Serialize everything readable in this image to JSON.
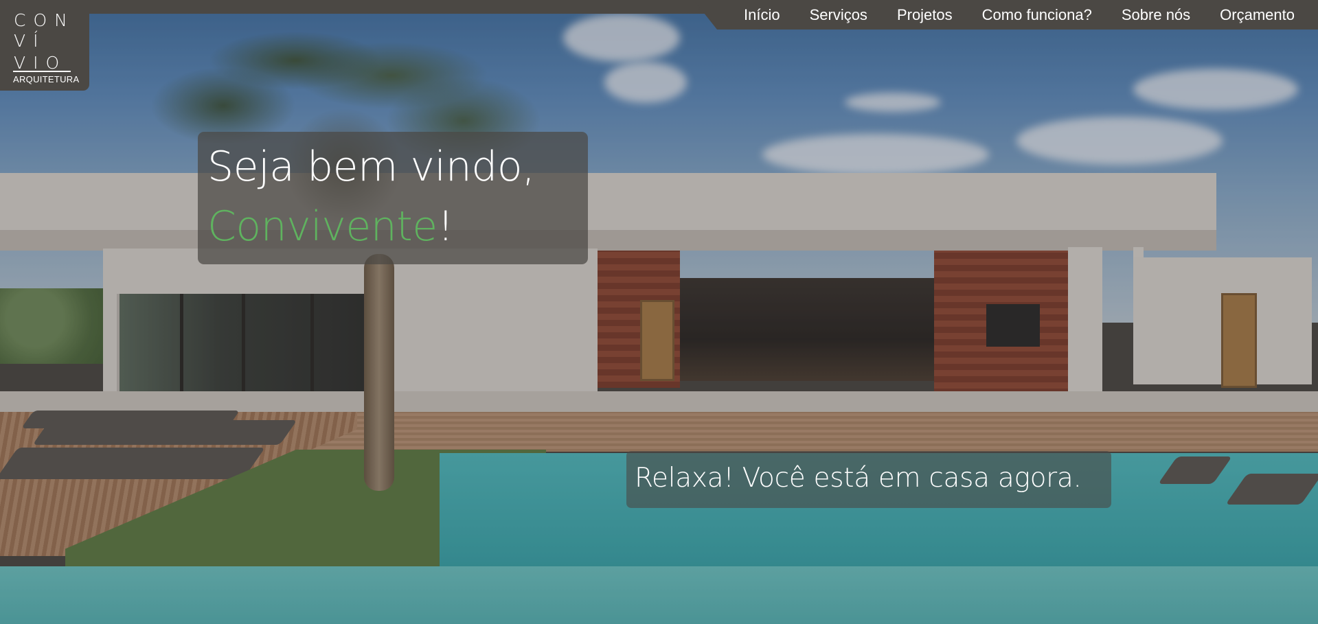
{
  "logo": {
    "line1": "CON",
    "line2": "VÍ",
    "line3": "VIO",
    "subtitle": "ARQUITETURA",
    "icon": "convivio-logo-icon"
  },
  "nav": {
    "items": [
      {
        "label": "Início"
      },
      {
        "label": "Serviços"
      },
      {
        "label": "Projetos"
      },
      {
        "label": "Como funciona?"
      },
      {
        "label": "Sobre nós"
      },
      {
        "label": "Orçamento"
      }
    ]
  },
  "hero": {
    "greeting": "Seja bem vindo,",
    "name": "Convivente",
    "punctuation": "!",
    "tagline": "Relaxa! Você está em casa agora."
  },
  "colors": {
    "nav_background": "#4b4844",
    "accent_green": "#5fb35f",
    "text": "#ffffff"
  }
}
